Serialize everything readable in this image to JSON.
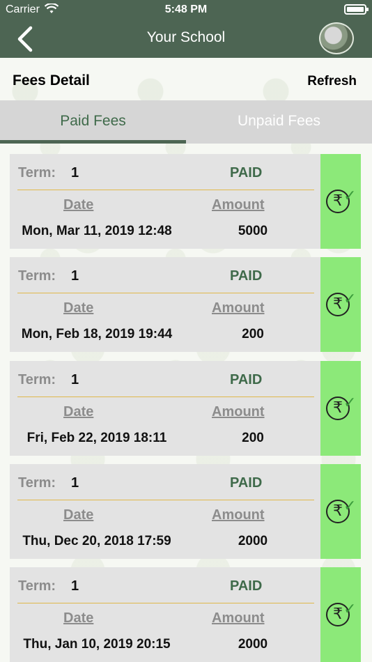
{
  "status_bar": {
    "carrier": "Carrier",
    "time": "5:48 PM"
  },
  "nav": {
    "title": "Your School"
  },
  "header": {
    "title": "Fees Detail",
    "refresh_label": "Refresh"
  },
  "tabs": [
    {
      "label": "Paid Fees",
      "active": true
    },
    {
      "label": "Unpaid Fees",
      "active": false
    }
  ],
  "labels": {
    "term": "Term:",
    "date": "Date",
    "amount": "Amount",
    "currency_symbol": "₹",
    "check": "✓"
  },
  "colors": {
    "nav_bg": "#4d6553",
    "paid_text": "#3f6a4a",
    "paid_badge": "#8ce979",
    "divider": "#e0b84a",
    "card_bg": "#e3e3e3"
  },
  "payments": [
    {
      "term": "1",
      "status": "PAID",
      "date": "Mon, Mar 11, 2019 12:48",
      "amount": "5000"
    },
    {
      "term": "1",
      "status": "PAID",
      "date": "Mon, Feb 18, 2019 19:44",
      "amount": "200"
    },
    {
      "term": "1",
      "status": "PAID",
      "date": "Fri, Feb 22, 2019 18:11",
      "amount": "200"
    },
    {
      "term": "1",
      "status": "PAID",
      "date": "Thu, Dec 20, 2018 17:59",
      "amount": "2000"
    },
    {
      "term": "1",
      "status": "PAID",
      "date": "Thu, Jan 10, 2019 20:15",
      "amount": "2000"
    }
  ]
}
